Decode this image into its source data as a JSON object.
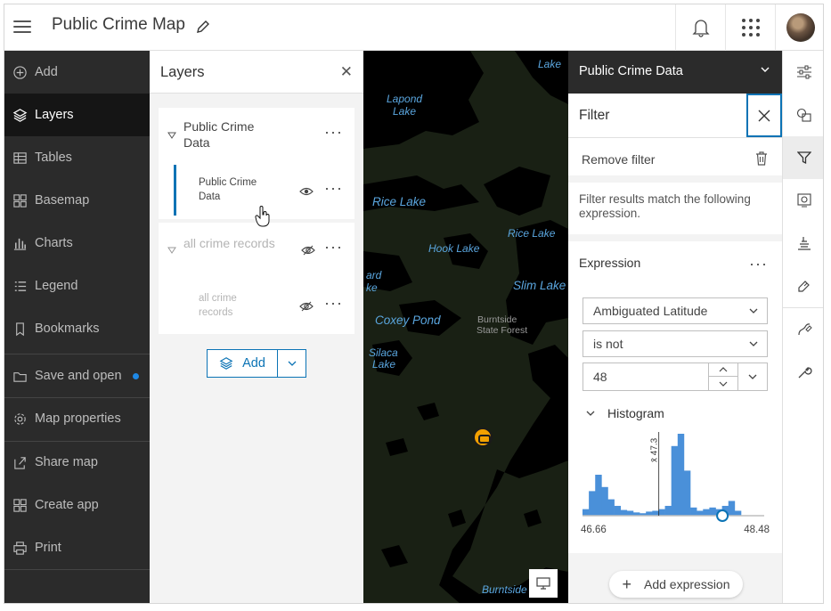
{
  "header": {
    "title": "Public Crime Map"
  },
  "leftnav": {
    "items": [
      {
        "label": "Add",
        "icon": "plus-circle-icon"
      },
      {
        "label": "Layers",
        "icon": "layers-icon"
      },
      {
        "label": "Tables",
        "icon": "table-icon"
      },
      {
        "label": "Basemap",
        "icon": "basemap-icon"
      },
      {
        "label": "Charts",
        "icon": "chart-icon"
      },
      {
        "label": "Legend",
        "icon": "legend-icon"
      },
      {
        "label": "Bookmarks",
        "icon": "bookmark-icon"
      },
      {
        "label": "Save and open",
        "icon": "folder-icon"
      },
      {
        "label": "Map properties",
        "icon": "gear-icon"
      },
      {
        "label": "Share map",
        "icon": "share-icon"
      },
      {
        "label": "Create app",
        "icon": "apps-icon"
      },
      {
        "label": "Print",
        "icon": "print-icon"
      }
    ],
    "active": "Layers",
    "save_indicator_color": "#1e88e5"
  },
  "layers": {
    "title": "Layers",
    "groups": [
      {
        "name": "Public Crime Data",
        "sublayer": "Public Crime Data",
        "visible": true
      },
      {
        "name": "all crime records",
        "sublayer": "all crime records",
        "visible": false
      }
    ],
    "add_label": "Add"
  },
  "map": {
    "labels": {
      "lake_top": "Lake",
      "lapond": "Lapond",
      "lapond2": "Lake",
      "rice_lake": "Rice Lake",
      "rice_lake2": "Rice Lake",
      "hook_lake": "Hook Lake",
      "slim_lake": "Slim Lake",
      "ward1": "ard",
      "ward2": "ke",
      "coxey": "Coxey Pond",
      "burntside1": "Burntside",
      "burntside2": "State Forest",
      "silaca1": "Silaca",
      "silaca2": "Lake",
      "burntside_lake": "Burntside"
    },
    "marker_color": "#f2a100"
  },
  "rpanel": {
    "layer_title": "Public Crime Data",
    "filter_title": "Filter",
    "remove_filter": "Remove filter",
    "match_text": "Filter results match the following expression.",
    "expression_title": "Expression",
    "field": "Ambiguated Latitude",
    "operator": "is not",
    "value": "48",
    "histogram_label": "Histogram",
    "histogram_mean_label": "x̄ 47.3",
    "histogram_min": "46.66",
    "histogram_max": "48.48",
    "add_expression": "Add expression",
    "accent": "#0b73b5",
    "bar_color": "#4a90d9"
  },
  "histogram": {
    "bins": [
      0.08,
      0.3,
      0.5,
      0.35,
      0.2,
      0.12,
      0.07,
      0.06,
      0.04,
      0.03,
      0.05,
      0.06,
      0.08,
      0.12,
      0.85,
      1.0,
      0.55,
      0.1,
      0.06,
      0.08,
      0.1,
      0.08,
      0.12,
      0.18,
      0.06
    ],
    "mean_fraction": 0.42,
    "slider_fraction": 0.77
  },
  "rtool": {
    "items": [
      "properties-icon",
      "styles-icon",
      "filter-icon",
      "effects-icon",
      "labels-icon",
      "configure-icon",
      "sketch-icon",
      "measure-icon"
    ]
  }
}
